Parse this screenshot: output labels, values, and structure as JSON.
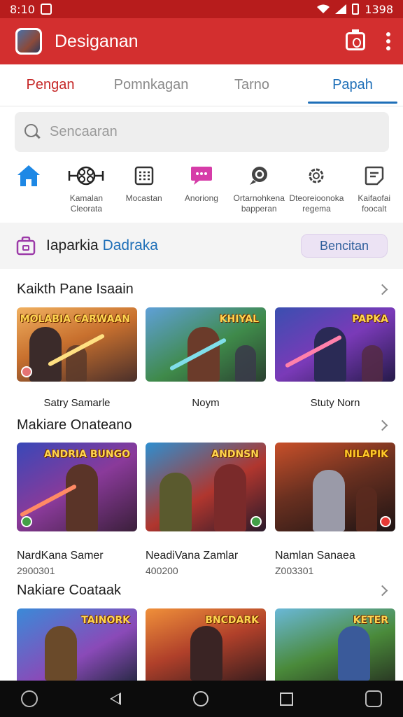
{
  "status_bar": {
    "time": "8:10",
    "battery": "1398"
  },
  "app_bar": {
    "title": "Desiganan"
  },
  "tabs": [
    {
      "label": "Pengan",
      "state": "accent"
    },
    {
      "label": "Pomnkagan",
      "state": "normal"
    },
    {
      "label": "Tarno",
      "state": "normal"
    },
    {
      "label": "Papah",
      "state": "selected"
    }
  ],
  "search": {
    "placeholder": "Sencaaran"
  },
  "categories": [
    {
      "icon": "home-icon",
      "label": ""
    },
    {
      "icon": "network-icon",
      "label": "Kamalan\nCleorata"
    },
    {
      "icon": "grid-icon",
      "label": "Mocastan"
    },
    {
      "icon": "chat-icon",
      "label": "Anoriong"
    },
    {
      "icon": "search-chat-icon",
      "label": "Ortarnohkena\nbapperan"
    },
    {
      "icon": "gear-icon",
      "label": "Dteoreioonoka\nregema"
    },
    {
      "icon": "note-icon",
      "label": "Kaifaofai\nfoocalt"
    }
  ],
  "promo": {
    "title_dark": "Iaparkia",
    "title_blue": "Dadraka",
    "button": "Bencitan"
  },
  "sections": [
    {
      "title": "Kaikth Pane Isaain",
      "cards": [
        {
          "name": "Satry Samarle",
          "sub": "",
          "logo": "MOLABIA CARWAAN"
        },
        {
          "name": "Noym",
          "sub": "",
          "logo": "KHIYAL"
        },
        {
          "name": "Stuty Norn",
          "sub": "",
          "logo": "PAPKA"
        }
      ]
    },
    {
      "title": "Makiare Onateano",
      "cards": [
        {
          "name": "NardKana Samer",
          "sub": "2900301",
          "logo": "ANDRIA BUNGO"
        },
        {
          "name": "NeadiVana Zamlar",
          "sub": "400200",
          "logo": "ANDNSN"
        },
        {
          "name": "Namlan Sanaea",
          "sub": "Z003301",
          "logo": "NILAPIK"
        }
      ]
    },
    {
      "title": "Nakiare Coataak",
      "cards": [
        {
          "name": "",
          "sub": "",
          "logo": "TAINORK"
        },
        {
          "name": "",
          "sub": "",
          "logo": "BNCDARK"
        },
        {
          "name": "",
          "sub": "",
          "logo": "KETER"
        }
      ]
    }
  ],
  "colors": {
    "brand": "#d32f2f",
    "accent_blue": "#1e6fb8",
    "status_bar": "#b71c1c"
  }
}
